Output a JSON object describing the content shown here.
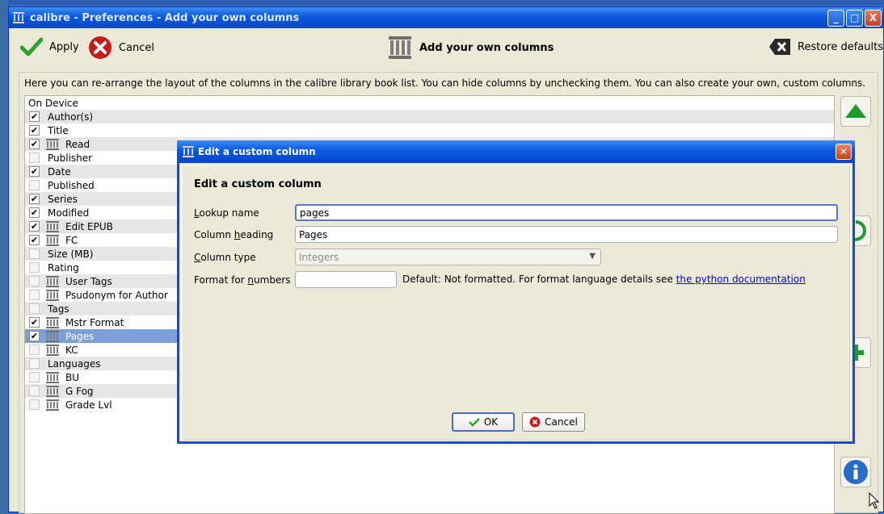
{
  "window": {
    "title": "calibre - Preferences - Add your own columns",
    "buttons": [
      "_",
      "□",
      "X"
    ]
  },
  "toolbar": {
    "apply_label": "Apply",
    "cancel_label": "Cancel",
    "heading": "Add your own columns",
    "restore_label": "Restore defaults"
  },
  "panel": {
    "description": "Here you can re-arrange the layout of the columns in the calibre library book list. You can hide columns by unchecking them. You can also create your own, custom columns."
  },
  "columns": [
    {
      "label": "On Device",
      "checked": null,
      "custom": false
    },
    {
      "label": "Author(s)",
      "checked": true,
      "custom": false
    },
    {
      "label": "Title",
      "checked": true,
      "custom": false
    },
    {
      "label": "Read",
      "checked": true,
      "custom": true
    },
    {
      "label": "Publisher",
      "checked": false,
      "custom": false
    },
    {
      "label": "Date",
      "checked": true,
      "custom": false
    },
    {
      "label": "Published",
      "checked": false,
      "custom": false
    },
    {
      "label": "Series",
      "checked": true,
      "custom": false
    },
    {
      "label": "Modified",
      "checked": true,
      "custom": false
    },
    {
      "label": "Edit EPUB",
      "checked": true,
      "custom": true
    },
    {
      "label": "FC",
      "checked": true,
      "custom": true
    },
    {
      "label": "Size (MB)",
      "checked": false,
      "custom": false
    },
    {
      "label": "Rating",
      "checked": false,
      "custom": false
    },
    {
      "label": "User Tags",
      "checked": false,
      "custom": true
    },
    {
      "label": "Psudonym for  Author",
      "checked": false,
      "custom": true
    },
    {
      "label": "Tags",
      "checked": false,
      "custom": false
    },
    {
      "label": "Mstr Format",
      "checked": true,
      "custom": true
    },
    {
      "label": "Pages",
      "checked": true,
      "custom": true,
      "selected": true
    },
    {
      "label": "KC",
      "checked": false,
      "custom": true
    },
    {
      "label": "Languages",
      "checked": false,
      "custom": false
    },
    {
      "label": "BU",
      "checked": false,
      "custom": true
    },
    {
      "label": "G Fog",
      "checked": false,
      "custom": true
    },
    {
      "label": "Grade Lvl",
      "checked": false,
      "custom": true
    }
  ],
  "dialog": {
    "title": "Edit a custom column",
    "heading": "Edit a custom column",
    "lookup_label_pre": "L",
    "lookup_label_post": "ookup name",
    "lookup_value": "pages",
    "heading_label_pre": "Column ",
    "heading_label_u": "h",
    "heading_label_post": "eading",
    "heading_value": "Pages",
    "type_label_pre": "C",
    "type_label_post": "olumn type",
    "type_value": "Integers",
    "format_label_pre": "Format for ",
    "format_label_u": "n",
    "format_label_post": "umbers",
    "format_value": "",
    "hint_text": "Default: Not formatted. For format language details see ",
    "hint_link": "the python documentation",
    "ok_label": "OK",
    "cancel_label": "Cancel"
  }
}
